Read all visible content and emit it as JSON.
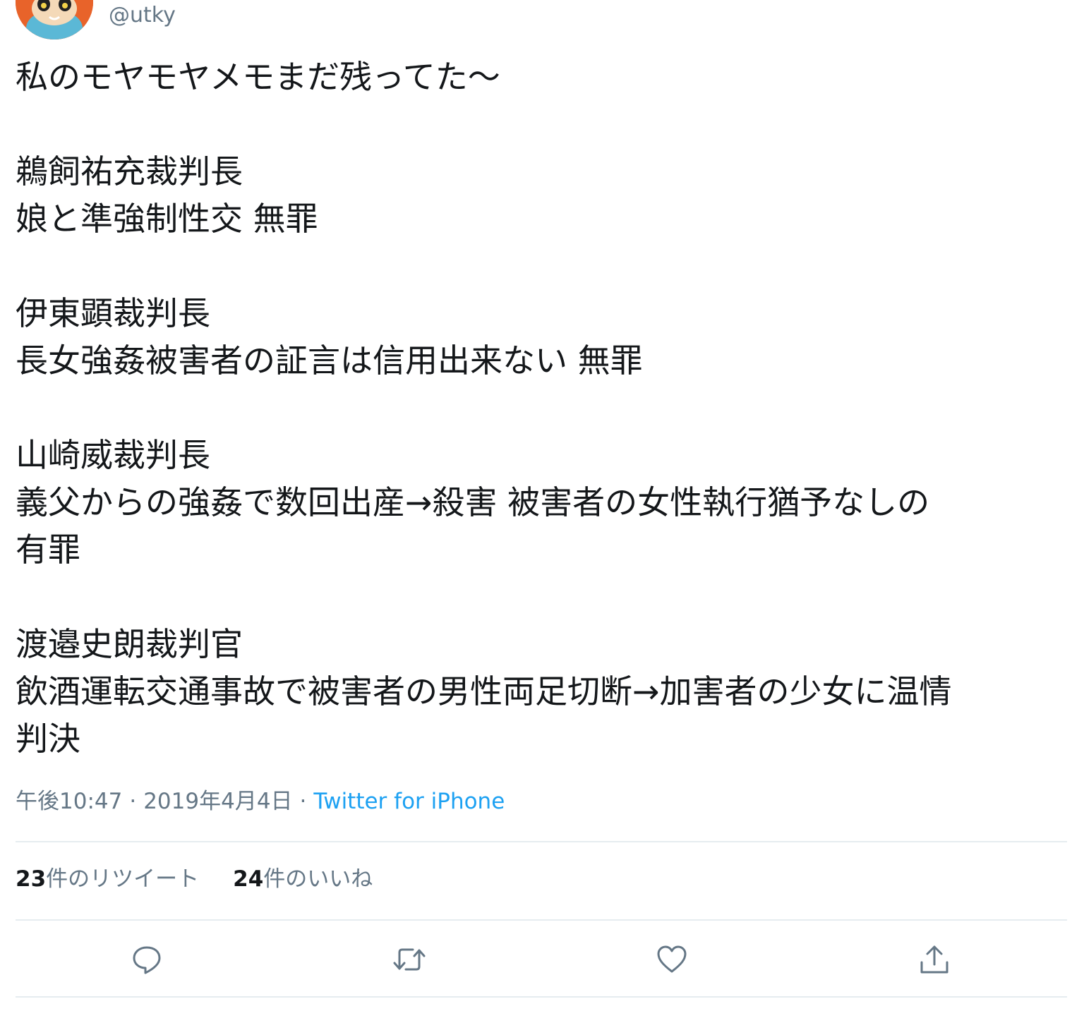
{
  "user": {
    "handle": "@utky"
  },
  "tweet": {
    "lines": [
      "私のモヤモヤメモまだ残ってた〜",
      "",
      "鵜飼祐充裁判長",
      "娘と準強制性交 無罪",
      "",
      "伊東顕裁判長",
      "長女強姦被害者の証言は信用出来ない 無罪",
      "",
      "山崎威裁判長",
      "義父からの強姦で数回出産→殺害 被害者の女性執行猶予なしの",
      "有罪",
      "",
      "渡邉史朗裁判官",
      "飲酒運転交通事故で被害者の男性両足切断→加害者の少女に温情",
      "判決"
    ]
  },
  "meta": {
    "time": "午後10:47",
    "separator": "·",
    "date": "2019年4月4日",
    "source": "Twitter for iPhone"
  },
  "stats": {
    "retweets_count": "23",
    "retweets_label": "件のリツイート",
    "likes_count": "24",
    "likes_label": "件のいいね"
  },
  "actions": {
    "reply_icon": "reply-icon",
    "retweet_icon": "retweet-icon",
    "like_icon": "heart-icon",
    "share_icon": "share-icon"
  },
  "colors": {
    "text": "#14171a",
    "secondary": "#657786",
    "link": "#1da1f2",
    "divider": "#e6ecf0"
  }
}
